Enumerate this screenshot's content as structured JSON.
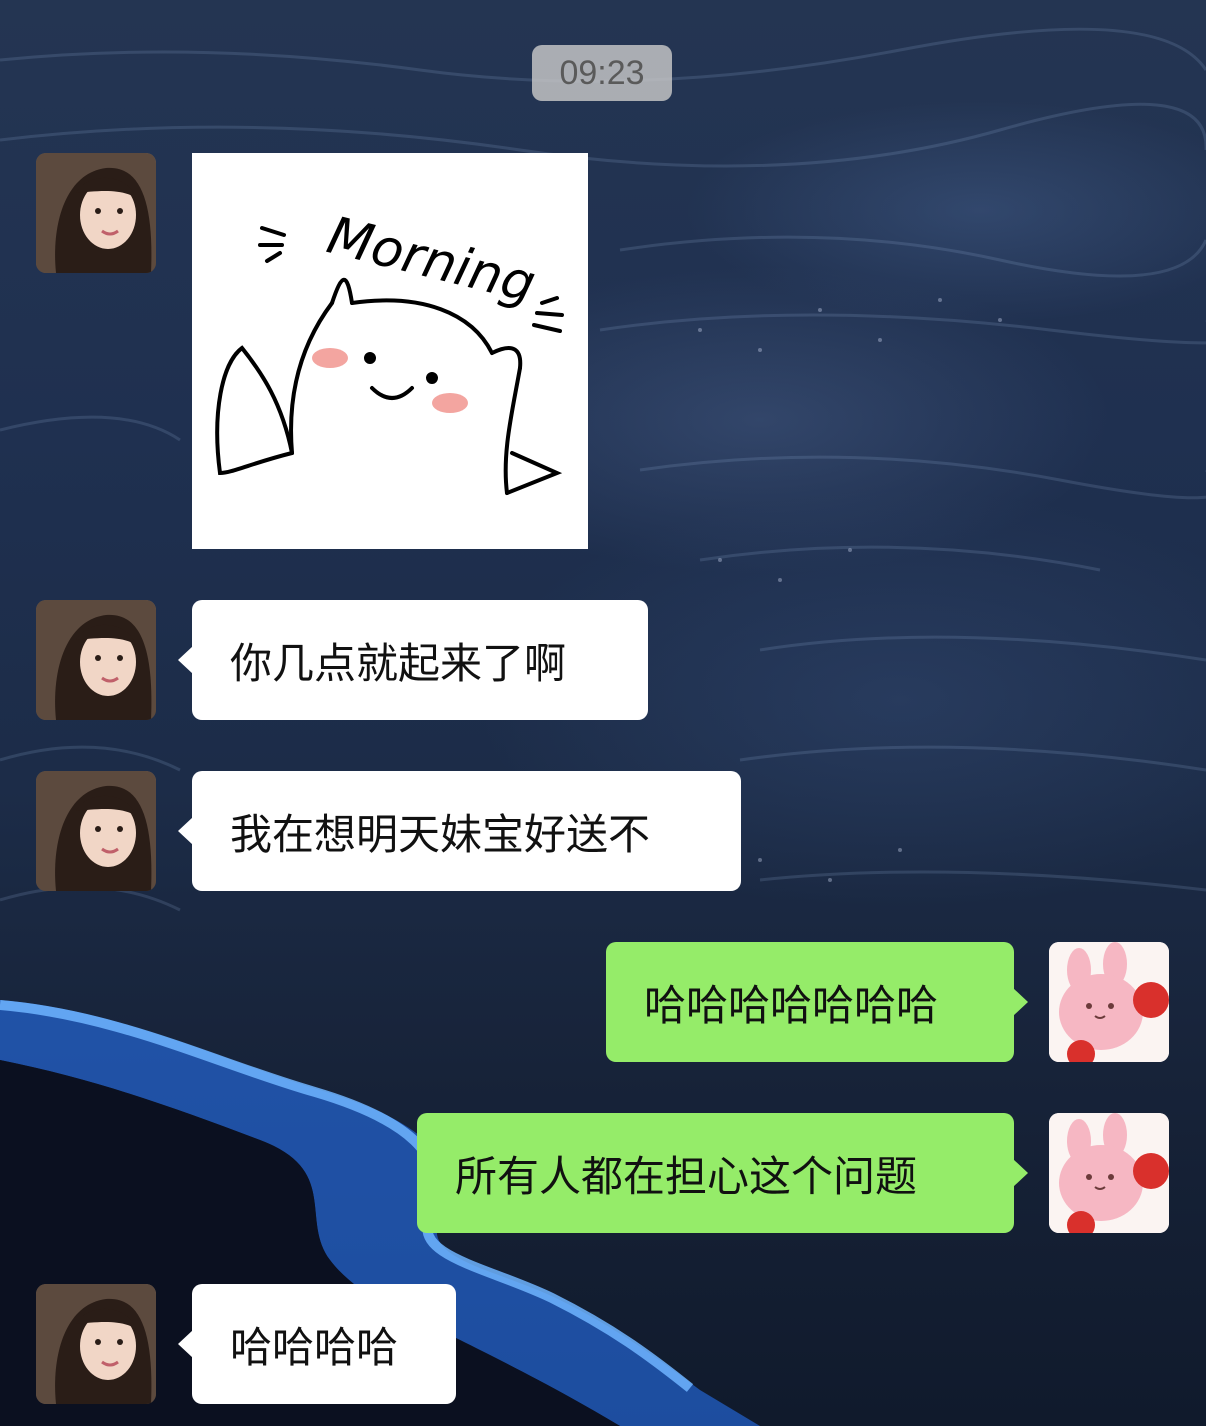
{
  "chat": {
    "timestamp": "09:23",
    "messages": [
      {
        "side": "left",
        "type": "sticker",
        "sticker_text": "Morning",
        "avatar": "girl-avatar"
      },
      {
        "side": "left",
        "type": "text",
        "text": "你几点就起来了啊",
        "avatar": "girl-avatar"
      },
      {
        "side": "left",
        "type": "text",
        "text": "我在想明天妹宝好送不",
        "avatar": "girl-avatar"
      },
      {
        "side": "right",
        "type": "text",
        "text": "哈哈哈哈哈哈哈",
        "avatar": "bunny-avatar"
      },
      {
        "side": "right",
        "type": "text",
        "text": "所有人都在担心这个问题",
        "avatar": "bunny-avatar"
      },
      {
        "side": "left",
        "type": "text",
        "text": "哈哈哈哈",
        "avatar": "girl-avatar"
      }
    ]
  },
  "colors": {
    "self_bubble": "#95ec69",
    "other_bubble": "#ffffff",
    "time_badge": "#c8c8c8"
  }
}
